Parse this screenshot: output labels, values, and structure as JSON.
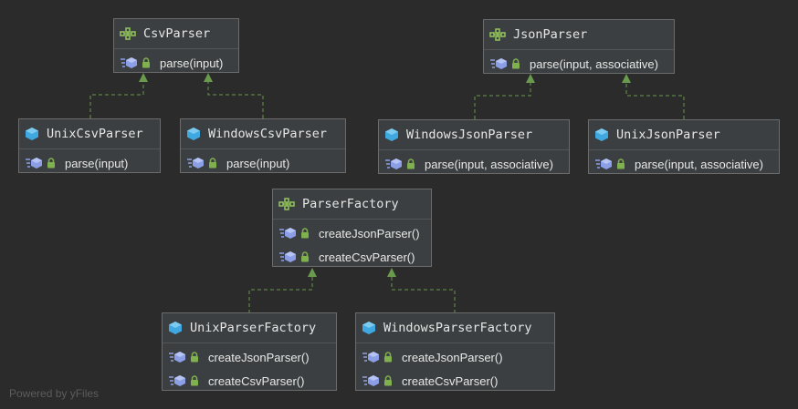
{
  "nodes": {
    "csv_parser": {
      "title": "CsvParser",
      "kind": "interface",
      "methods": [
        "parse(input)"
      ]
    },
    "json_parser": {
      "title": "JsonParser",
      "kind": "interface",
      "methods": [
        "parse(input, associative)"
      ]
    },
    "unix_csv_parser": {
      "title": "UnixCsvParser",
      "kind": "class",
      "methods": [
        "parse(input)"
      ]
    },
    "windows_csv_parser": {
      "title": "WindowsCsvParser",
      "kind": "class",
      "methods": [
        "parse(input)"
      ]
    },
    "windows_json_parser": {
      "title": "WindowsJsonParser",
      "kind": "class",
      "methods": [
        "parse(input, associative)"
      ]
    },
    "unix_json_parser": {
      "title": "UnixJsonParser",
      "kind": "class",
      "methods": [
        "parse(input, associative)"
      ]
    },
    "parser_factory": {
      "title": "ParserFactory",
      "kind": "interface",
      "methods": [
        "createJsonParser()",
        "createCsvParser()"
      ]
    },
    "unix_parser_factory": {
      "title": "UnixParserFactory",
      "kind": "class",
      "methods": [
        "createJsonParser()",
        "createCsvParser()"
      ]
    },
    "windows_parser_factory": {
      "title": "WindowsParserFactory",
      "kind": "class",
      "methods": [
        "createJsonParser()",
        "createCsvParser()"
      ]
    }
  },
  "edges": [
    {
      "from": "unix_csv_parser",
      "to": "csv_parser",
      "type": "implements"
    },
    {
      "from": "windows_csv_parser",
      "to": "csv_parser",
      "type": "implements"
    },
    {
      "from": "windows_json_parser",
      "to": "json_parser",
      "type": "implements"
    },
    {
      "from": "unix_json_parser",
      "to": "json_parser",
      "type": "implements"
    },
    {
      "from": "unix_parser_factory",
      "to": "parser_factory",
      "type": "implements"
    },
    {
      "from": "windows_parser_factory",
      "to": "parser_factory",
      "type": "implements"
    }
  ],
  "icons": {
    "interface": "interface-icon",
    "class": "class-icon",
    "method": "method-icon",
    "visibility": "lock-icon"
  },
  "colors": {
    "background": "#2b2b2b",
    "node_fill": "#3c3f41",
    "edge": "#6a9a4e",
    "class_icon": "#40a8e0",
    "interface_icon": "#8fbf5a",
    "lock": "#7fb24f"
  },
  "watermark": "Powered by yFiles"
}
